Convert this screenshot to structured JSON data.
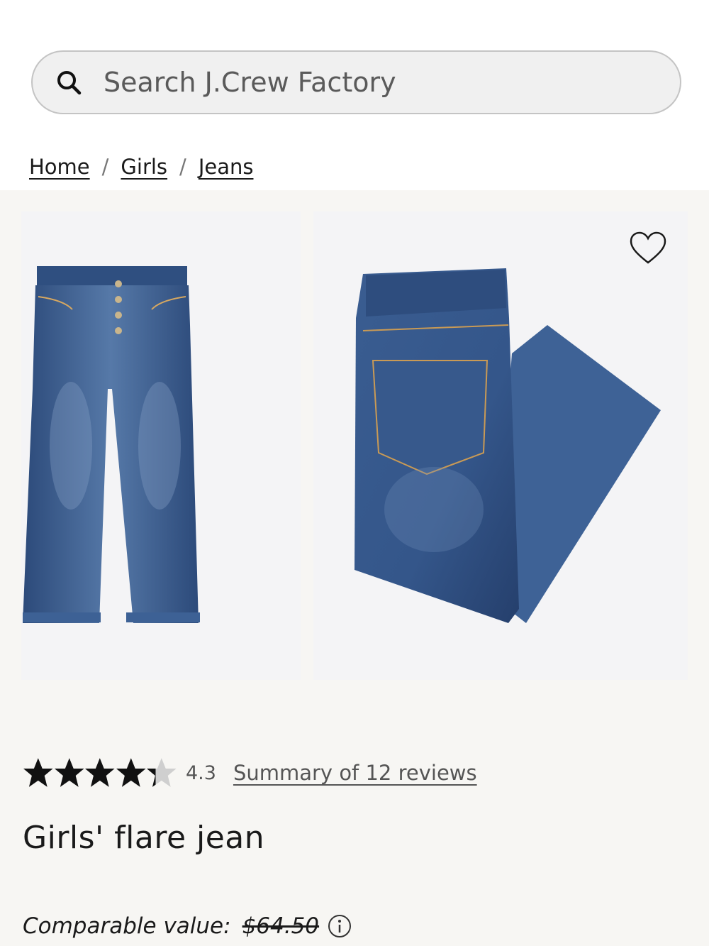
{
  "search": {
    "placeholder": "Search J.Crew Factory"
  },
  "breadcrumb": {
    "items": [
      "Home",
      "Girls",
      "Jeans"
    ],
    "separator": "/"
  },
  "gallery": {
    "images": [
      {
        "alt": "front view"
      },
      {
        "alt": "back view folded"
      }
    ],
    "wishlist_icon": "heart-icon"
  },
  "product": {
    "rating": 4.3,
    "rating_label": "4.3",
    "rating_max": 5,
    "reviews_link": "Summary of 12 reviews",
    "title": "Girls' flare jean",
    "comparable_label": "Comparable value:",
    "comparable_price": "$64.50",
    "info_icon": "info-icon"
  },
  "colors": {
    "denim": "#3c5f92",
    "denim_dark": "#2b4675",
    "star_filled": "#111111",
    "star_empty": "#cfcfcf",
    "gallery_bg": "#f7f6f3"
  }
}
